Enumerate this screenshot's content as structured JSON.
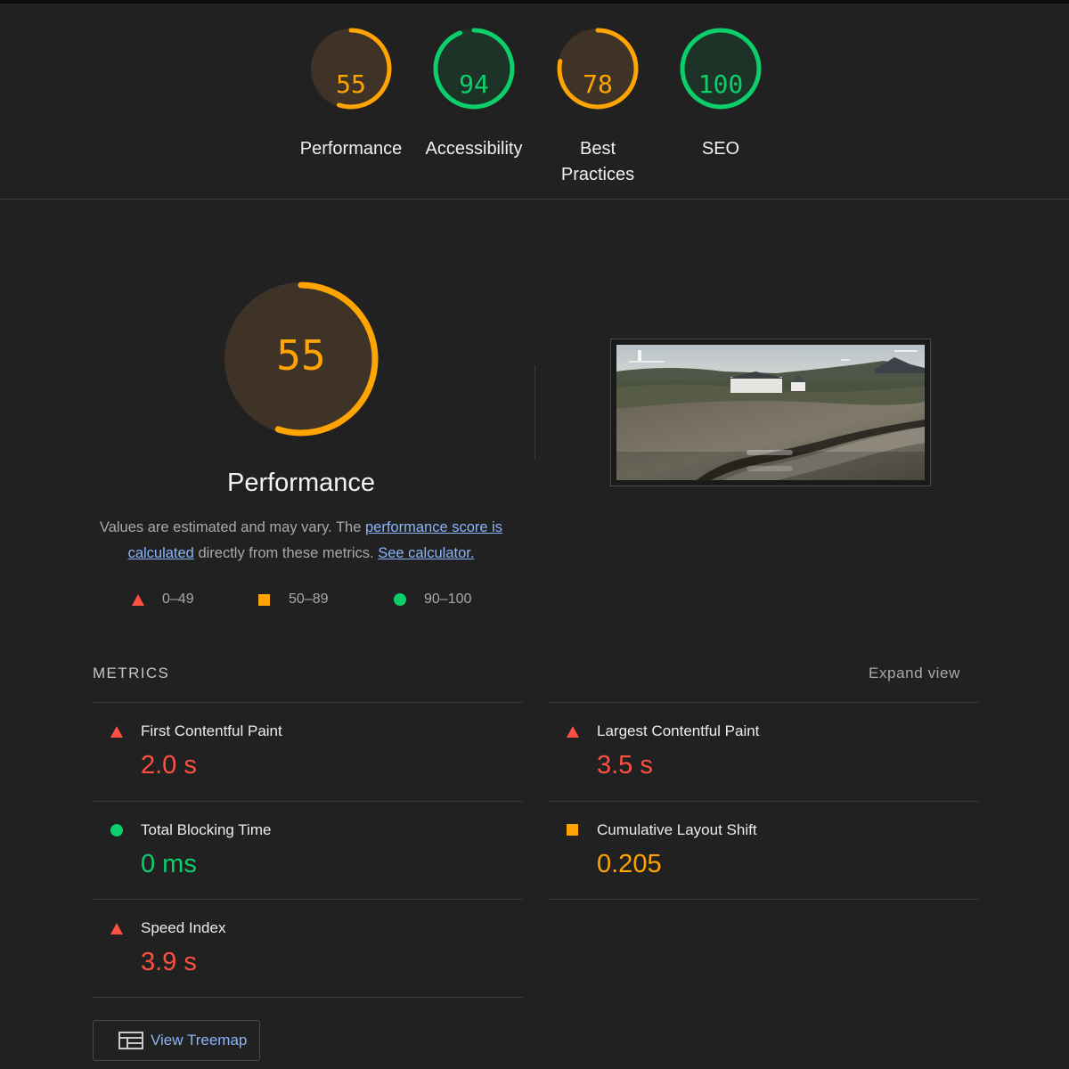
{
  "colors": {
    "fail": "#ff4e42",
    "average": "#ffa400",
    "pass": "#0cce6b",
    "fail_bg": "#3d2524",
    "average_bg": "#3e3326",
    "pass_bg": "#1e3328",
    "link": "#8ab4f8"
  },
  "categories": [
    {
      "label": "Performance",
      "score": "55",
      "fraction": 0.55,
      "rating": "average"
    },
    {
      "label": "Accessibility",
      "score": "94",
      "fraction": 0.94,
      "rating": "pass"
    },
    {
      "label": "Best Practices",
      "label_line1": "Best",
      "label_line2": "Practices",
      "score": "78",
      "fraction": 0.78,
      "rating": "average"
    },
    {
      "label": "SEO",
      "score": "100",
      "fraction": 1.0,
      "rating": "pass"
    }
  ],
  "performance": {
    "title": "Performance",
    "score": "55",
    "fraction": 0.55,
    "description_before": "Values are estimated and may vary. The ",
    "score_link": "performance score is calculated",
    "description_middle": " directly from these metrics. ",
    "calculator_link": "See calculator."
  },
  "legend": [
    {
      "range": "0–49",
      "icon": "fail-triangle-icon"
    },
    {
      "range": "50–89",
      "icon": "average-square-icon"
    },
    {
      "range": "90–100",
      "icon": "pass-circle-icon"
    }
  ],
  "metrics": {
    "title": "METRICS",
    "expand_label": "Expand view",
    "items": [
      {
        "label": "First Contentful Paint",
        "value": "2.0 s",
        "rating": "fail"
      },
      {
        "label": "Largest Contentful Paint",
        "value": "3.5 s",
        "rating": "fail"
      },
      {
        "label": "Total Blocking Time",
        "value": "0 ms",
        "rating": "pass"
      },
      {
        "label": "Cumulative Layout Shift",
        "value": "0.205",
        "rating": "average"
      },
      {
        "label": "Speed Index",
        "value": "3.9 s",
        "rating": "fail"
      }
    ]
  },
  "treemap_button": {
    "label": "View Treemap",
    "icon": "treemap-icon"
  }
}
